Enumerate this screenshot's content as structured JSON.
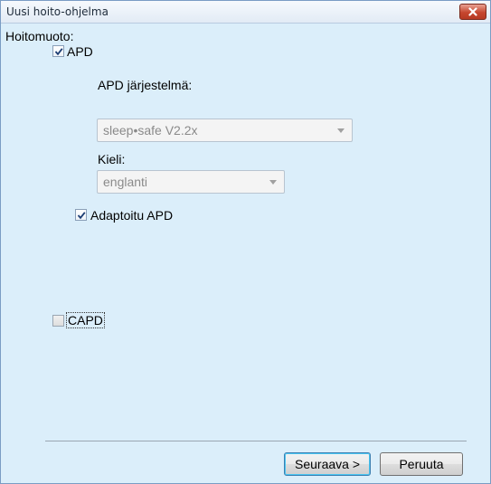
{
  "window": {
    "title": "Uusi hoito-ohjelma"
  },
  "form": {
    "section_label": "Hoitomuoto:",
    "apd": {
      "label": "APD",
      "checked": true
    },
    "apd_system": {
      "label": "APD järjestelmä:",
      "value": "sleep•safe V2.2x"
    },
    "language": {
      "label": "Kieli:",
      "value": "englanti"
    },
    "adapted_apd": {
      "label": "Adaptoitu APD",
      "checked": true
    },
    "capd": {
      "label": "CAPD",
      "checked": false
    }
  },
  "buttons": {
    "next": "Seuraava >",
    "cancel": "Peruuta"
  },
  "icons": {
    "close": "close-icon",
    "checkmark": "check-icon",
    "dropdown": "chevron-down-icon"
  }
}
